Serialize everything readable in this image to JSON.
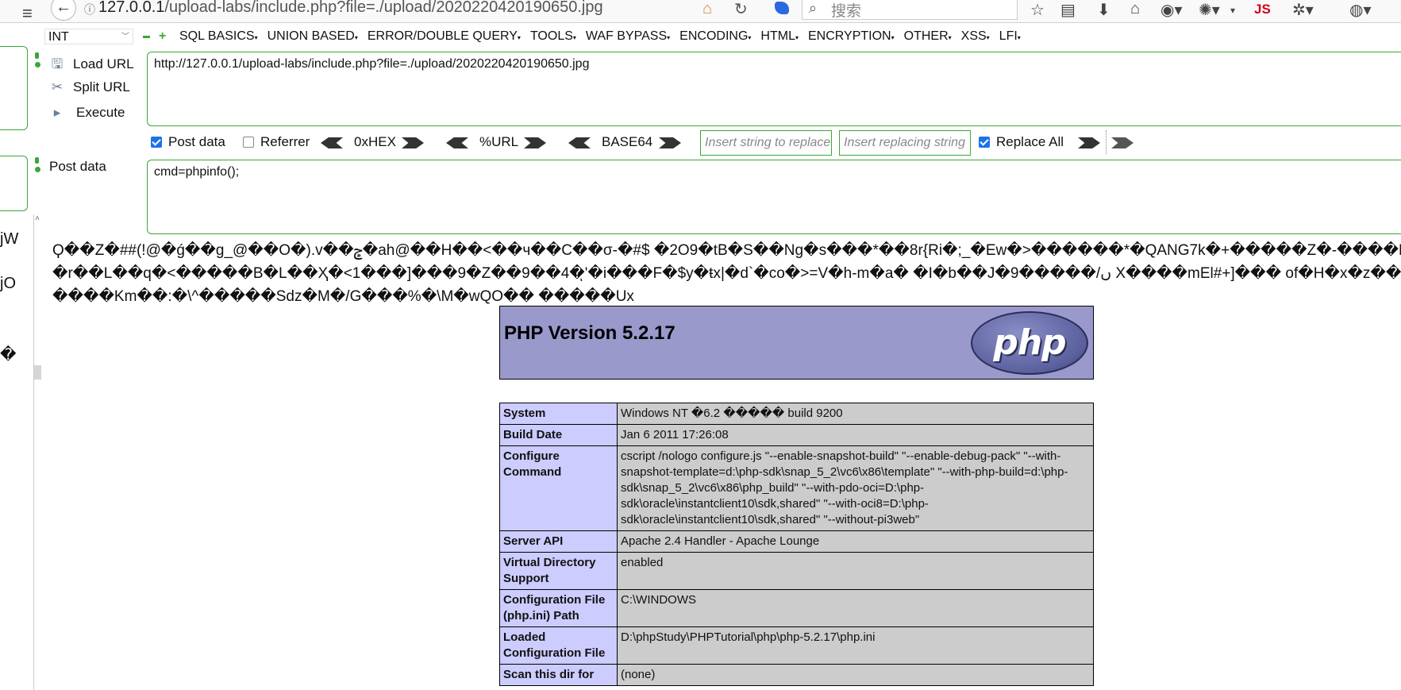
{
  "browser": {
    "url": "127.0.0.1/upload-labs/include.php?file=./upload/2020220420190650.jpg",
    "search_placeholder": "搜索",
    "js_badge": "JS"
  },
  "hackbar": {
    "int_select": "INT",
    "menus": [
      "SQL BASICS",
      "UNION BASED",
      "ERROR/DOUBLE QUERY",
      "TOOLS",
      "WAF BYPASS",
      "ENCODING",
      "HTML",
      "ENCRYPTION",
      "OTHER",
      "XSS",
      "LFI"
    ],
    "load_url": "Load URL",
    "split_url": "Split URL",
    "execute": "Execute",
    "url_value": "http://127.0.0.1/upload-labs/include.php?file=./upload/2020220420190650.jpg",
    "post_data_label": "Post data",
    "post_data_value": "cmd=phpinfo();",
    "opt_post_data": "Post data",
    "opt_post_data_checked": true,
    "opt_referrer": "Referrer",
    "opt_referrer_checked": false,
    "hex_label": "0xHEX",
    "url_label": "%URL",
    "base64_label": "BASE64",
    "insert_string_placeholder": "Insert string to replace",
    "insert_replacing_placeholder": "Insert replacing string",
    "replace_all": "Replace All",
    "replace_all_checked": true
  },
  "side_fragments": [
    "јW",
    "јO",
    "�"
  ],
  "garbage_lines": [
    "Ϙ��Z�##(ǃ@�ǵ��g_@��O�).v��ݮ�ah@��H��<��ч��C��σ-�#$ �2O9�tB�S��Ng�s���*��8r{Ri�;_�Ew�>������*�QANG7k�+�����Z�-����Ė���",
    "�r��L��q�<�����B�L��Ҳ�<1���]���9�Z��9��4�ͅ'�i���F�$y�ŧx|�d`�co�>=V�h-m�a� �I�b��J�9�����/ں X����mEl#+]��� of�H�x�z��",
    "����Km��:�\\^�����Sdz�M�/G���%�\\M�wQO�� �����Ux"
  ],
  "phpinfo": {
    "title": "PHP Version 5.2.17",
    "logo_text": "php",
    "rows": [
      {
        "key": "System",
        "value": "Windows NT �6.2 ����� build 9200"
      },
      {
        "key": "Build Date",
        "value": "Jan 6 2011 17:26:08"
      },
      {
        "key": "Configure Command",
        "value": "cscript /nologo configure.js \"--enable-snapshot-build\" \"--enable-debug-pack\" \"--with-snapshot-template=d:\\php-sdk\\snap_5_2\\vc6\\x86\\template\" \"--with-php-build=d:\\php-sdk\\snap_5_2\\vc6\\x86\\php_build\" \"--with-pdo-oci=D:\\php-sdk\\oracle\\instantclient10\\sdk,shared\" \"--with-oci8=D:\\php-sdk\\oracle\\instantclient10\\sdk,shared\" \"--without-pi3web\""
      },
      {
        "key": "Server API",
        "value": "Apache 2.4 Handler - Apache Lounge"
      },
      {
        "key": "Virtual Directory Support",
        "value": "enabled"
      },
      {
        "key": "Configuration File (php.ini) Path",
        "value": "C:\\WINDOWS"
      },
      {
        "key": "Loaded Configuration File",
        "value": "D:\\phpStudy\\PHPTutorial\\php\\php-5.2.17\\php.ini"
      },
      {
        "key": "Scan this dir for",
        "value": "(none)"
      }
    ]
  }
}
